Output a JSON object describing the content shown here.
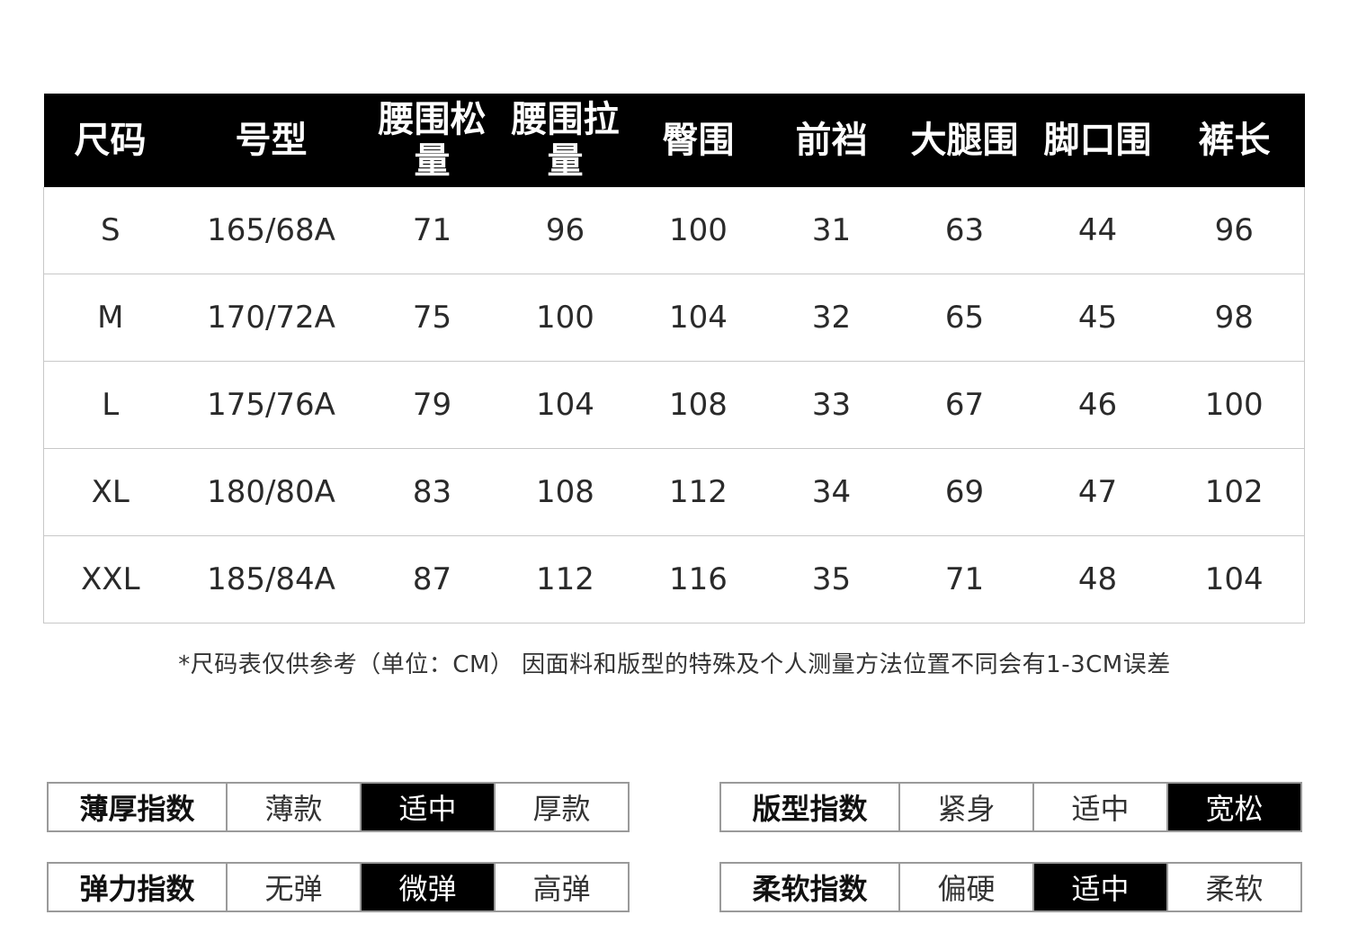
{
  "table": {
    "headers": [
      "尺码",
      "号型",
      "腰围松量",
      "腰围拉量",
      "臀围",
      "前裆",
      "大腿围",
      "脚口围",
      "裤长"
    ],
    "rows": [
      [
        "S",
        "165/68A",
        "71",
        "96",
        "100",
        "31",
        "63",
        "44",
        "96"
      ],
      [
        "M",
        "170/72A",
        "75",
        "100",
        "104",
        "32",
        "65",
        "45",
        "98"
      ],
      [
        "L",
        "175/76A",
        "79",
        "104",
        "108",
        "33",
        "67",
        "46",
        "100"
      ],
      [
        "XL",
        "180/80A",
        "83",
        "108",
        "112",
        "34",
        "69",
        "47",
        "102"
      ],
      [
        "XXL",
        "185/84A",
        "87",
        "112",
        "116",
        "35",
        "71",
        "48",
        "104"
      ]
    ]
  },
  "note": "*尺码表仅供参考（单位：CM） 因面料和版型的特殊及个人测量方法位置不同会有1-3CM误差",
  "indices": [
    {
      "label": "薄厚指数",
      "options": [
        "薄款",
        "适中",
        "厚款"
      ],
      "selected": 1
    },
    {
      "label": "版型指数",
      "options": [
        "紧身",
        "适中",
        "宽松"
      ],
      "selected": 2
    },
    {
      "label": "弹力指数",
      "options": [
        "无弹",
        "微弹",
        "高弹"
      ],
      "selected": 1
    },
    {
      "label": "柔软指数",
      "options": [
        "偏硬",
        "适中",
        "柔软"
      ],
      "selected": 1
    }
  ]
}
